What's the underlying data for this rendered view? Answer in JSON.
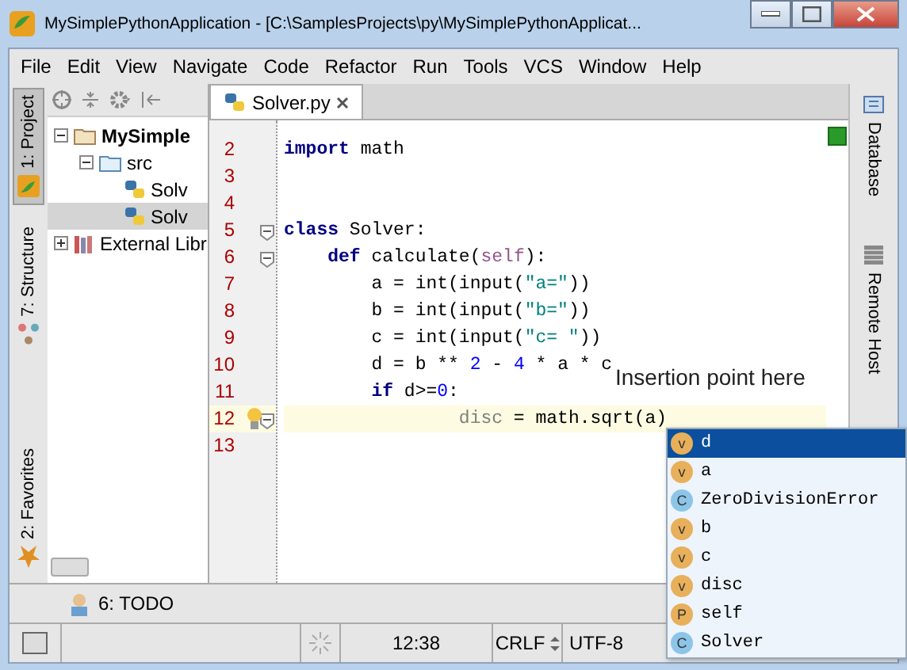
{
  "window": {
    "title": "MySimplePythonApplication - [C:\\SamplesProjects\\py\\MySimplePythonApplicat..."
  },
  "menu": [
    {
      "label": "File"
    },
    {
      "label": "Edit"
    },
    {
      "label": "View"
    },
    {
      "label": "Navigate"
    },
    {
      "label": "Code"
    },
    {
      "label": "Refactor"
    },
    {
      "label": "Run"
    },
    {
      "label": "Tools"
    },
    {
      "label": "VCS"
    },
    {
      "label": "Window"
    },
    {
      "label": "Help"
    }
  ],
  "left_tools": [
    {
      "label": "1: Project",
      "selected": true
    },
    {
      "label": "7: Structure",
      "selected": false
    },
    {
      "label": "2: Favorites",
      "selected": false
    }
  ],
  "right_tools": [
    {
      "label": "Database"
    },
    {
      "label": "Remote Host"
    }
  ],
  "project_tree": [
    {
      "label": "MySimple",
      "kind": "project",
      "expanded": true,
      "selected": false,
      "children": [
        {
          "label": "src",
          "kind": "folder",
          "expanded": true,
          "selected": false,
          "children": [
            {
              "label": "Solv",
              "kind": "python",
              "selected": false
            },
            {
              "label": "Solv",
              "kind": "python",
              "selected": true
            }
          ]
        }
      ]
    },
    {
      "label": "External Libr",
      "kind": "library",
      "expanded": false,
      "selected": false
    }
  ],
  "editor_tab": {
    "label": "Solver.py"
  },
  "code_lines": [
    {
      "number": "2",
      "current": false,
      "tokens": [
        {
          "t": "import",
          "kind": "kw"
        },
        {
          "t": " math",
          "kind": "plain"
        }
      ]
    },
    {
      "number": "3",
      "current": false
    },
    {
      "number": "4",
      "current": false
    },
    {
      "number": "5",
      "current": false,
      "fold": true,
      "tokens": [
        {
          "t": "class",
          "kind": "kw"
        },
        {
          "t": " Solver:",
          "kind": "plain"
        }
      ]
    },
    {
      "number": "6",
      "current": false,
      "fold": true,
      "tokens": [
        {
          "t": "    def",
          "kind": "kw"
        },
        {
          "t": " calculate(",
          "kind": "plain"
        },
        {
          "t": "self",
          "kind": "self"
        },
        {
          "t": "):",
          "kind": "plain"
        }
      ]
    },
    {
      "number": "7",
      "current": false,
      "tokens": [
        {
          "t": "        a = int(input(",
          "kind": "plain"
        },
        {
          "t": "\"a=\"",
          "kind": "str"
        },
        {
          "t": "))",
          "kind": "plain"
        }
      ]
    },
    {
      "number": "8",
      "current": false,
      "tokens": [
        {
          "t": "        b = int(input(",
          "kind": "plain"
        },
        {
          "t": "\"b=\"",
          "kind": "str"
        },
        {
          "t": "))",
          "kind": "plain"
        }
      ]
    },
    {
      "number": "9",
      "current": false,
      "tokens": [
        {
          "t": "        c = int(input(",
          "kind": "plain"
        },
        {
          "t": "\"c= \"",
          "kind": "str"
        },
        {
          "t": "))",
          "kind": "plain"
        }
      ]
    },
    {
      "number": "10",
      "current": false,
      "tokens": [
        {
          "t": "        d = b ** ",
          "kind": "plain"
        },
        {
          "t": "2",
          "kind": "num"
        },
        {
          "t": " - ",
          "kind": "plain"
        },
        {
          "t": "4",
          "kind": "num"
        },
        {
          "t": " * a * c",
          "kind": "plain"
        }
      ]
    },
    {
      "number": "11",
      "current": false,
      "tokens": [
        {
          "t": "        if",
          "kind": "kw"
        },
        {
          "t": " d>=",
          "kind": "plain"
        },
        {
          "t": "0",
          "kind": "num"
        },
        {
          "t": ":",
          "kind": "plain"
        }
      ]
    },
    {
      "number": "12",
      "current": true,
      "fold": true,
      "bulb": true,
      "tokens": [
        {
          "t": "                disc",
          "kind": "dim"
        },
        {
          "t": " = math.sqrt(a)",
          "kind": "plain"
        }
      ]
    },
    {
      "number": "13",
      "current": false
    }
  ],
  "annotation": "Insertion point here",
  "completion": [
    {
      "name": "d",
      "kind": "v",
      "selected": true
    },
    {
      "name": "a",
      "kind": "v",
      "selected": false
    },
    {
      "name": "ZeroDivisionError",
      "kind": "C",
      "selected": false
    },
    {
      "name": "b",
      "kind": "v",
      "selected": false
    },
    {
      "name": "c",
      "kind": "v",
      "selected": false
    },
    {
      "name": "disc",
      "kind": "v",
      "selected": false
    },
    {
      "name": "self",
      "kind": "P",
      "selected": false
    },
    {
      "name": "Solver",
      "kind": "C",
      "selected": false
    }
  ],
  "bottom_tool": {
    "label": "6: TODO"
  },
  "status_bar": {
    "position": "12:38",
    "line_separator": "CRLF",
    "encoding": "UTF-8"
  }
}
